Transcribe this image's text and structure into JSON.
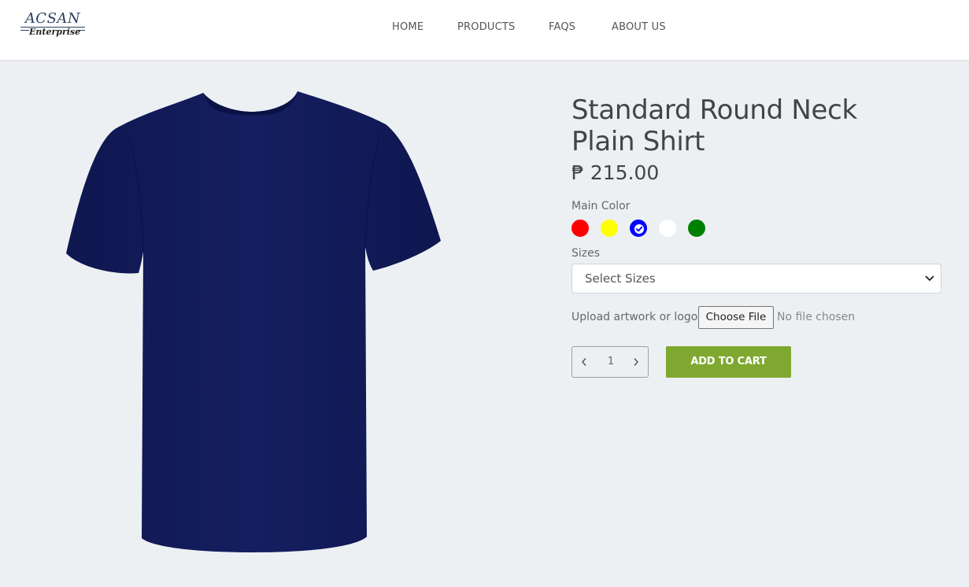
{
  "brand": {
    "name_top": "ACSAN",
    "name_bottom": "Enterprise"
  },
  "nav": {
    "items": [
      {
        "label": "HOME"
      },
      {
        "label": "PRODUCTS"
      },
      {
        "label": "FAQS"
      },
      {
        "label": "ABOUT US"
      }
    ]
  },
  "product": {
    "title_line1": "Standard Round Neck",
    "title_line2": "Plain Shirt",
    "price": "₱ 215.00",
    "image_icon": "tshirt-image",
    "shirt_color": "#141d5e",
    "color_label": "Main Color",
    "colors": [
      {
        "name": "red",
        "hex": "#ff0000",
        "selected": false
      },
      {
        "name": "yellow",
        "hex": "#ffff00",
        "selected": false
      },
      {
        "name": "blue",
        "hex": "#0000ff",
        "selected": true
      },
      {
        "name": "white",
        "hex": "#ffffff",
        "selected": false
      },
      {
        "name": "green",
        "hex": "#008000",
        "selected": false
      }
    ],
    "sizes_label": "Sizes",
    "sizes_placeholder": "Select Sizes",
    "upload_label": "Upload artwork or logo",
    "file_button": "Choose File",
    "file_status": "No file chosen",
    "quantity": "1",
    "add_to_cart": "ADD TO CART",
    "accent_color": "#7fa831"
  }
}
